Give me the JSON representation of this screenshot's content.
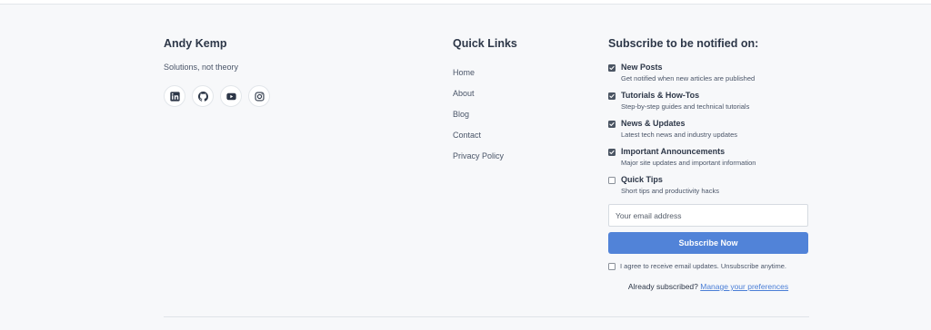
{
  "brand": {
    "name": "Andy Kemp",
    "tagline": "Solutions, not theory",
    "socials": [
      {
        "icon": "linkedin-icon"
      },
      {
        "icon": "github-icon"
      },
      {
        "icon": "youtube-icon"
      },
      {
        "icon": "instagram-icon"
      }
    ]
  },
  "quick_links": {
    "title": "Quick Links",
    "items": [
      "Home",
      "About",
      "Blog",
      "Contact",
      "Privacy Policy"
    ]
  },
  "subscribe": {
    "title": "Subscribe to be notified on:",
    "options": [
      {
        "label": "New Posts",
        "description": "Get notified when new articles are published",
        "checked": true
      },
      {
        "label": "Tutorials & How-Tos",
        "description": "Step-by-step guides and technical tutorials",
        "checked": true
      },
      {
        "label": "News & Updates",
        "description": "Latest tech news and industry updates",
        "checked": true
      },
      {
        "label": "Important Announcements",
        "description": "Major site updates and important information",
        "checked": true
      },
      {
        "label": "Quick Tips",
        "description": "Short tips and productivity hacks",
        "checked": false
      }
    ],
    "email_placeholder": "Your email address",
    "email_value": "",
    "button_label": "Subscribe Now",
    "consent_text": "I agree to receive email updates. Unsubscribe anytime.",
    "consent_checked": false,
    "already_text": "Already subscribed?",
    "manage_link": "Manage your preferences"
  },
  "colors": {
    "background": "#f7f8fa",
    "accent": "#5183d8",
    "link": "#4a7ed6",
    "heading": "#2d3748"
  }
}
